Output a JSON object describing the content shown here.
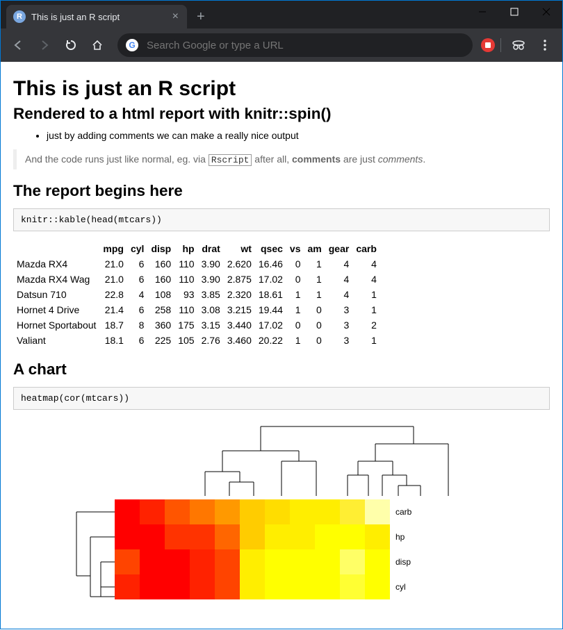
{
  "browser": {
    "tab_title": "This is just an R script",
    "omnibox_placeholder": "Search Google or type a URL"
  },
  "doc": {
    "h1": "This is just an R script",
    "h2_sub": "Rendered to a html report with knitr::spin()",
    "bullet1": "just by adding comments we can make a really nice output",
    "bq_pre": "And the code runs just like normal, eg. via ",
    "bq_code": "Rscript",
    "bq_mid": " after all, ",
    "bq_bold": "comments",
    "bq_post": " are just ",
    "bq_em": "comments",
    "bq_end": ".",
    "h2_report": "The report begins here",
    "code1": "knitr::kable(head(mtcars))",
    "h2_chart": "A chart",
    "code2": "heatmap(cor(mtcars))"
  },
  "table": {
    "headers": [
      "",
      "mpg",
      "cyl",
      "disp",
      "hp",
      "drat",
      "wt",
      "qsec",
      "vs",
      "am",
      "gear",
      "carb"
    ],
    "rows": [
      [
        "Mazda RX4",
        "21.0",
        "6",
        "160",
        "110",
        "3.90",
        "2.620",
        "16.46",
        "0",
        "1",
        "4",
        "4"
      ],
      [
        "Mazda RX4 Wag",
        "21.0",
        "6",
        "160",
        "110",
        "3.90",
        "2.875",
        "17.02",
        "0",
        "1",
        "4",
        "4"
      ],
      [
        "Datsun 710",
        "22.8",
        "4",
        "108",
        "93",
        "3.85",
        "2.320",
        "18.61",
        "1",
        "1",
        "4",
        "1"
      ],
      [
        "Hornet 4 Drive",
        "21.4",
        "6",
        "258",
        "110",
        "3.08",
        "3.215",
        "19.44",
        "1",
        "0",
        "3",
        "1"
      ],
      [
        "Hornet Sportabout",
        "18.7",
        "8",
        "360",
        "175",
        "3.15",
        "3.440",
        "17.02",
        "0",
        "0",
        "3",
        "2"
      ],
      [
        "Valiant",
        "18.1",
        "6",
        "225",
        "105",
        "2.76",
        "3.460",
        "20.22",
        "1",
        "0",
        "3",
        "1"
      ]
    ]
  },
  "chart_data": {
    "type": "heatmap",
    "title": "",
    "row_labels_visible": [
      "carb",
      "hp",
      "disp",
      "cyl"
    ],
    "col_count": 11,
    "palette": [
      "#ff0000",
      "#ff3300",
      "#ff6600",
      "#ff9900",
      "#ffcc00",
      "#ffff00",
      "#ffff66",
      "#ffffaa"
    ],
    "grid_colors": [
      [
        "#ff0000",
        "#ff2200",
        "#ff5500",
        "#ff7700",
        "#ff9900",
        "#ffcc00",
        "#ffdd00",
        "#ffee00",
        "#ffee00",
        "#ffee33",
        "#ffffaa"
      ],
      [
        "#ff0000",
        "#ff0000",
        "#ff3300",
        "#ff3300",
        "#ff6600",
        "#ffcc00",
        "#ffee00",
        "#ffee00",
        "#ffff00",
        "#ffff00",
        "#ffee00"
      ],
      [
        "#ff4400",
        "#ff0000",
        "#ff0000",
        "#ff2200",
        "#ff4400",
        "#ffee00",
        "#ffff00",
        "#ffff00",
        "#ffff00",
        "#ffff66",
        "#ffff00"
      ],
      [
        "#ff2200",
        "#ff0000",
        "#ff0000",
        "#ff2200",
        "#ff4400",
        "#ffee00",
        "#ffff00",
        "#ffff00",
        "#ffff00",
        "#ffff33",
        "#ffff00"
      ]
    ],
    "correlation_note": "Rendered top 4 visible rows of cor(mtcars) heatmap; values approximate."
  }
}
